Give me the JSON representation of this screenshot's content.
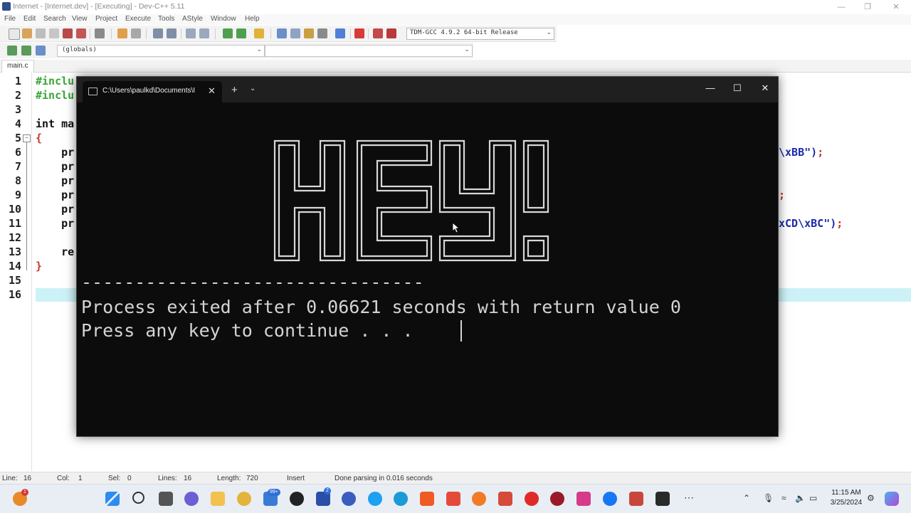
{
  "ide": {
    "title": "Internet - [Internet.dev] - [Executing] - Dev-C++ 5.11",
    "menu": [
      "File",
      "Edit",
      "Search",
      "View",
      "Project",
      "Execute",
      "Tools",
      "AStyle",
      "Window",
      "Help"
    ],
    "compiler": "TDM-GCC 4.9.2 64-bit Release",
    "scope": "(globals)",
    "function": "",
    "tab": "main.c",
    "code_lines": [
      {
        "num": "1",
        "parts": [
          {
            "t": "#inclu",
            "c": "pre"
          }
        ]
      },
      {
        "num": "2",
        "parts": [
          {
            "t": "#inclu",
            "c": "pre"
          }
        ]
      },
      {
        "num": "3",
        "parts": []
      },
      {
        "num": "4",
        "parts": [
          {
            "t": "int ma",
            "c": "kw"
          }
        ]
      },
      {
        "num": "5",
        "parts": [
          {
            "t": "{",
            "c": "brace"
          }
        ]
      },
      {
        "num": "6",
        "parts": [
          {
            "t": "    pr",
            "c": "kw"
          }
        ],
        "right": [
          {
            "t": "\\xBB\")",
            "c": "str"
          },
          {
            "t": ";",
            "c": "sc"
          }
        ]
      },
      {
        "num": "7",
        "parts": [
          {
            "t": "    pr",
            "c": "kw"
          }
        ]
      },
      {
        "num": "8",
        "parts": [
          {
            "t": "    pr",
            "c": "kw"
          }
        ]
      },
      {
        "num": "9",
        "parts": [
          {
            "t": "    pr",
            "c": "kw"
          }
        ],
        "right": [
          {
            "t": ";",
            "c": "sc"
          }
        ]
      },
      {
        "num": "10",
        "parts": [
          {
            "t": "    pr",
            "c": "kw"
          }
        ]
      },
      {
        "num": "11",
        "parts": [
          {
            "t": "    pr",
            "c": "kw"
          }
        ],
        "right": [
          {
            "t": "xCD\\xBC\")",
            "c": "str"
          },
          {
            "t": ";",
            "c": "sc"
          }
        ]
      },
      {
        "num": "12",
        "parts": []
      },
      {
        "num": "13",
        "parts": [
          {
            "t": "    re",
            "c": "kw"
          }
        ]
      },
      {
        "num": "14",
        "parts": [
          {
            "t": "}",
            "c": "brace"
          }
        ]
      },
      {
        "num": "15",
        "parts": []
      },
      {
        "num": "16",
        "parts": []
      }
    ],
    "status": {
      "line_label": "Line:",
      "line": "16",
      "col_label": "Col:",
      "col": "1",
      "sel_label": "Sel:",
      "sel": "0",
      "lines_label": "Lines:",
      "lines": "16",
      "length_label": "Length:",
      "length": "720",
      "mode": "Insert",
      "message": "Done parsing in 0.016 seconds"
    }
  },
  "terminal": {
    "tab_title": "C:\\Users\\paulkd\\Documents\\I",
    "banner": "HEY!",
    "divider": "--------------------------------",
    "line1": "Process exited after 0.06621 seconds with return value 0",
    "line2": "Press any key to continue . . ."
  },
  "taskbar": {
    "time": "11:15 AM",
    "date": "3/25/2024",
    "badges": {
      "orange": "1",
      "mail": "99+",
      "l": "2"
    }
  }
}
